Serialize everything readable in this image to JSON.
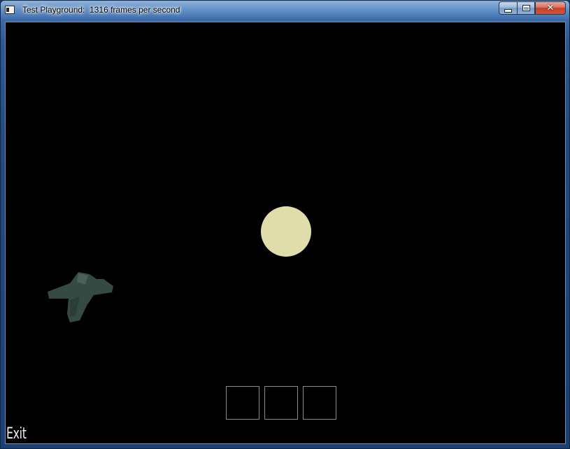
{
  "window": {
    "title": "Test Playground:  1316 frames per second",
    "caption_buttons": {
      "minimize": "minimize",
      "maximize": "maximize",
      "close": "✕"
    }
  },
  "scene": {
    "background_color": "#000000",
    "sun_color": "#dfdeaa",
    "ship_color": "#344a42",
    "slot_count": 3,
    "exit_label": "Exit"
  }
}
